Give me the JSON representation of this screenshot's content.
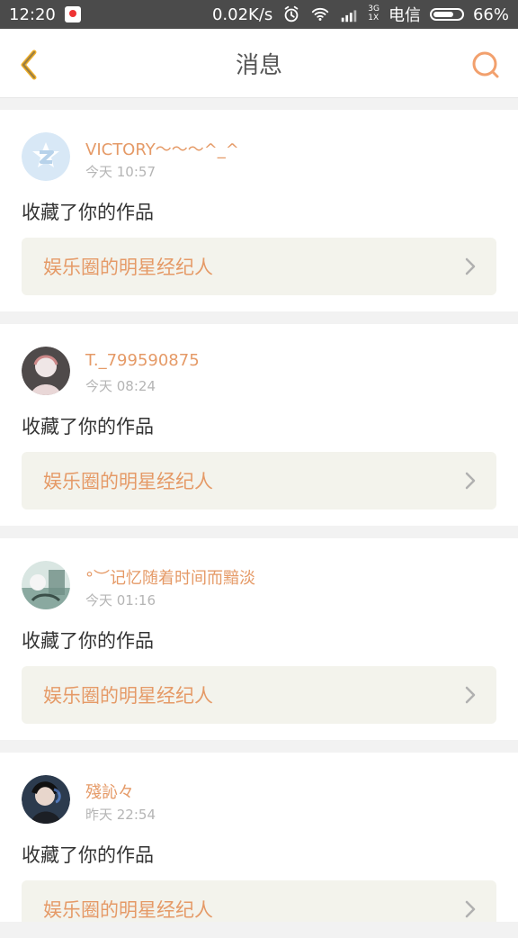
{
  "status": {
    "time": "12:20",
    "net_speed": "0.02K/s",
    "network_small_top": "3G",
    "network_small_bottom": "1X",
    "carrier": "电信",
    "battery_percent": "66%"
  },
  "header": {
    "title": "消息"
  },
  "messages": [
    {
      "username": "VICTORY～～～^_^",
      "time": "今天 10:57",
      "action": "收藏了你的作品",
      "work_title": "娱乐圈的明星经纪人",
      "avatar": "qq-default-avatar"
    },
    {
      "username": "T._799590875",
      "time": "今天 08:24",
      "action": "收藏了你的作品",
      "work_title": "娱乐圈的明星经纪人",
      "avatar": "user-avatar"
    },
    {
      "username": "°︶记忆随着时间而黯淡",
      "time": "今天 01:16",
      "action": "收藏了你的作品",
      "work_title": "娱乐圈的明星经纪人",
      "avatar": "user-avatar"
    },
    {
      "username": "殘訫々",
      "time": "昨天 22:54",
      "action": "收藏了你的作品",
      "work_title": "娱乐圈的明星经纪人",
      "avatar": "user-avatar"
    }
  ],
  "colors": {
    "accent": "#e59a67",
    "background": "#f2f2f2",
    "card_link_bg": "#f3f3ec"
  }
}
